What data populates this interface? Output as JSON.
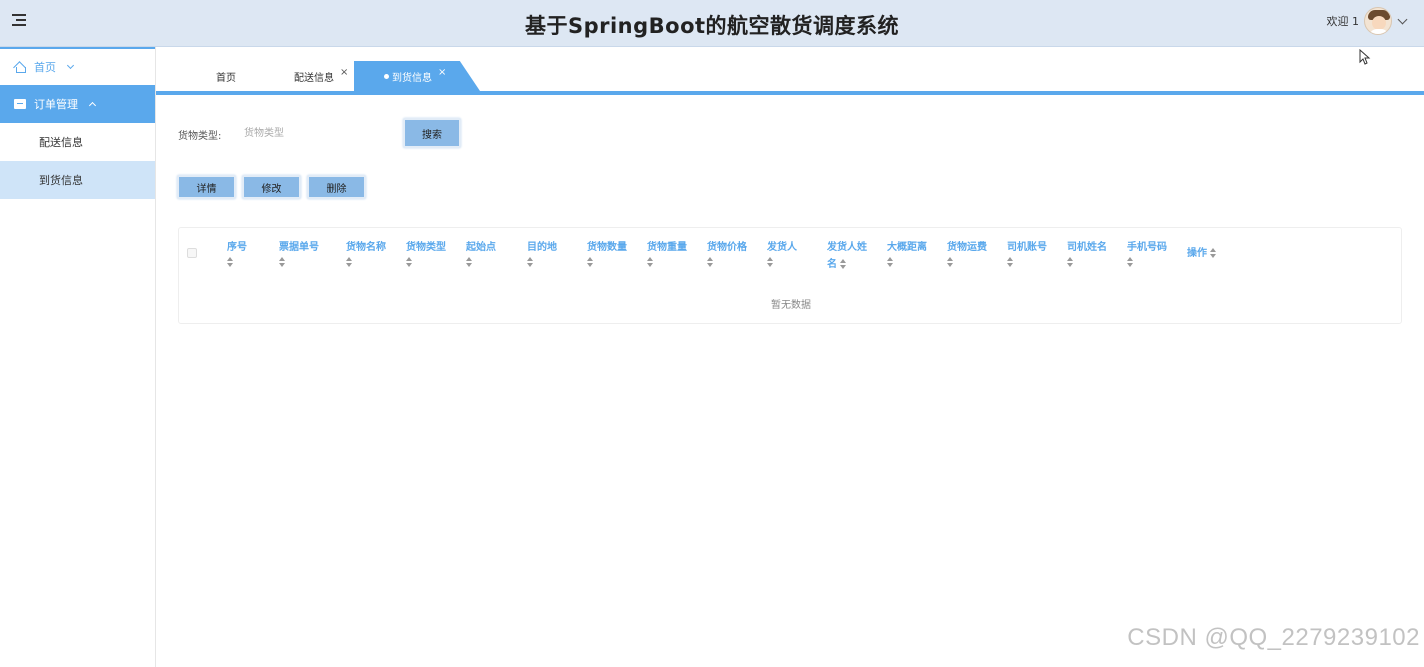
{
  "header": {
    "title": "基于SpringBoot的航空散货调度系统",
    "welcome": "欢迎 1"
  },
  "sidebar": {
    "home": "首页",
    "orders": "订单管理",
    "items": [
      "配送信息",
      "到货信息"
    ],
    "active_item": "到货信息"
  },
  "tabs": {
    "home": "首页",
    "delivery": "配送信息",
    "arrival": "到货信息",
    "close_glyph": "×"
  },
  "search": {
    "label": "货物类型:",
    "placeholder": "货物类型",
    "button": "搜索"
  },
  "actions": {
    "detail": "详情",
    "edit": "修改",
    "delete": "删除"
  },
  "table": {
    "columns": [
      "序号",
      "票据单号",
      "货物名称",
      "货物类型",
      "起始点",
      "目的地",
      "货物数量",
      "货物重量",
      "货物价格",
      "发货人",
      "发货人姓名",
      "大概距离",
      "货物运费",
      "司机账号",
      "司机姓名",
      "手机号码",
      "操作"
    ],
    "empty_text": "暂无数据"
  },
  "watermark": "CSDN @QQ_2279239102",
  "colors": {
    "accent": "#5aa8ec",
    "header_bg": "#dde7f3",
    "button_bg": "#8ab9e6"
  }
}
